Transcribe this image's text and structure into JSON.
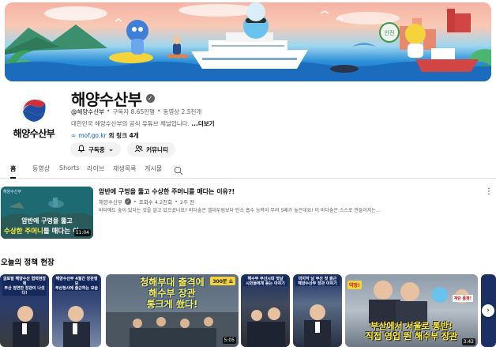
{
  "banner": {
    "badge": "안전"
  },
  "channel": {
    "title": "해양수산부",
    "avatar_text": "해양수산부",
    "handle": "@해양수산부",
    "subscribers": "구독자 8.65만명",
    "videos": "동영상 2.5천개",
    "description": "대한민국 해양수산부의 공식 유튜브 채널입니다.",
    "more_label": "...더보기",
    "link_url": "mof.go.kr",
    "more_links": "외 링크 4개",
    "subscribe_label": "구독중",
    "community_label": "커뮤니티"
  },
  "tabs": [
    {
      "label": "홈"
    },
    {
      "label": "동영상"
    },
    {
      "label": "Shorts"
    },
    {
      "label": "라이브"
    },
    {
      "label": "재생목록"
    },
    {
      "label": "게시물"
    }
  ],
  "featured": {
    "title": "암반에 구멍을 뚫고 수상한 주머니를 매다는 이유?!",
    "channel": "해양수산부",
    "views": "조회수 4.2천회",
    "age": "2주 전",
    "description": "바다에도 숲이 있다는 것을 알고 있으셨나요? 바다숲은 엘대우림보다 탄소 흡수 능력이 무려 5배가 높은데요! 이 바다숲은 스스로 만들어지는...",
    "thumb_logo": "해양수산부",
    "thumb_caption_1": "암반에 구멍을 뚫고",
    "thumb_caption_2a": "수상한 주머니",
    "thumb_caption_2b": "를 매다는 이",
    "duration": "11:04"
  },
  "section": {
    "title": "오늘의 정책 현장",
    "cards": [
      {
        "caption": "글로벌 해양수산 협력현장에\n부산 정연만 장관이 나섰다!",
        "duration": ""
      },
      {
        "caption": "해양수산부 4월간 장관행보\n부산청사에 출근하는 모습",
        "duration": ""
      },
      {
        "caption": "청해부대 출격에\n해수부 장관\n통크게 쐈다!",
        "duration": "5:05"
      },
      {
        "caption": "해수부 부산시대 첫날\n시민들에게 듣는 이야기",
        "duration": ""
      },
      {
        "caption": "마지막 날 부산 첫 출근\n해양수산부 장관 이야기",
        "duration": ""
      },
      {
        "caption": "부산에서 서울로 통반!\n직접 영업 뛴 해수부 장관",
        "duration": "3:42"
      }
    ],
    "badge_1": "300분 쇼",
    "badge_2": "약장!",
    "badge_3": "계란 품평!"
  }
}
